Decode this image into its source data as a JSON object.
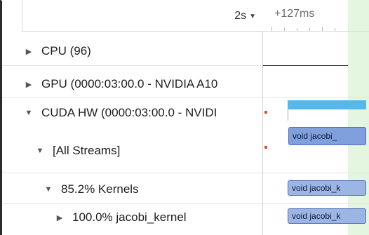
{
  "header": {
    "zoom_label": "2s",
    "ruler_label": "+127ms"
  },
  "tree": {
    "rows": [
      {
        "caret": "▶",
        "label": "CPU (96)"
      },
      {
        "caret": "▶",
        "label": "GPU (0000:03:00.0 - NVIDIA A10"
      },
      {
        "caret": "▼",
        "label": "CUDA HW (0000:03:00.0 - NVIDI"
      },
      {
        "caret": "▼",
        "label": "[All Streams]"
      },
      {
        "caret": "▼",
        "label": "85.2% Kernels"
      },
      {
        "caret": "▶",
        "label": "100.0% jacobi_kernel"
      }
    ]
  },
  "timeline": {
    "kernels": [
      {
        "label": "void jacobi_"
      },
      {
        "label": "void jacobi_k"
      },
      {
        "label": "void jacobi_k"
      }
    ]
  },
  "colors": {
    "kernel_bar": "#7f9fdd",
    "cuda_bar": "#56b7ec",
    "marker": "#e0502a",
    "highlight_band": "#e4f6df"
  }
}
